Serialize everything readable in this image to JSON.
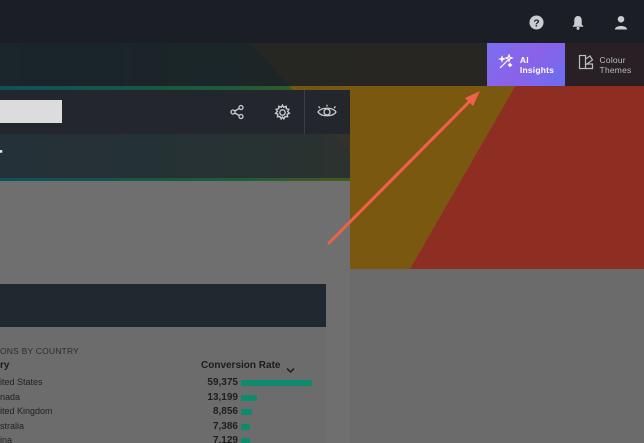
{
  "header": {
    "icons": [
      "help-icon",
      "bell-icon",
      "user-icon"
    ]
  },
  "toolbar": {
    "ai_insights": {
      "line1": "AI",
      "line2": "Insights"
    },
    "colour_themes": {
      "line1": "Colour",
      "line2": "Themes"
    }
  },
  "dashboard": {
    "title_fragment": "r",
    "tools": [
      "share-icon",
      "settings-icon",
      "eye-icon"
    ]
  },
  "card": {
    "subtitle": "ONS BY COUNTRY",
    "col_left": "ry",
    "col_right": "Conversion Rate",
    "rows": [
      {
        "name": "ited States",
        "value": "59,375",
        "pct": 1.0
      },
      {
        "name": "nada",
        "value": "13,199",
        "pct": 0.222
      },
      {
        "name": "ited Kingdom",
        "value": "8,856",
        "pct": 0.149
      },
      {
        "name": "stralia",
        "value": "7,386",
        "pct": 0.124
      },
      {
        "name": "ina",
        "value": "7,129",
        "pct": 0.12
      }
    ]
  },
  "colors": {
    "accent_start": "#7b6ff0",
    "accent_end": "#6a6ef2",
    "bar_color": "#0f8a6c",
    "arrow_color": "#f0604a"
  }
}
